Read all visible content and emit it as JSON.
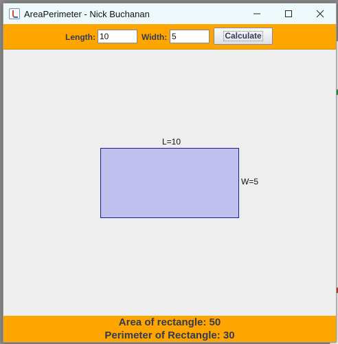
{
  "window": {
    "title": "AreaPerimeter - Nick Buchanan"
  },
  "toolbar": {
    "length_label": "Length:",
    "length_value": "10",
    "width_label": "Width:",
    "width_value": "5",
    "calculate_label": "Calculate"
  },
  "canvas": {
    "length_label": "L=10",
    "width_label": "W=5",
    "rectangle": {
      "length": 10,
      "width": 5,
      "fill_color": "#c0c0ef",
      "stroke_color": "#1a1a9a"
    }
  },
  "results": {
    "area_text": "Area of rectangle: 50",
    "perimeter_text": "Perimeter of Rectangle: 30"
  },
  "colors": {
    "accent": "#ffa500",
    "label_text": "#333a55",
    "titlebar": "#eef9fb"
  },
  "icons": {
    "app": "java-app-icon",
    "minimize": "minimize-icon",
    "maximize": "maximize-icon",
    "close": "close-icon"
  }
}
